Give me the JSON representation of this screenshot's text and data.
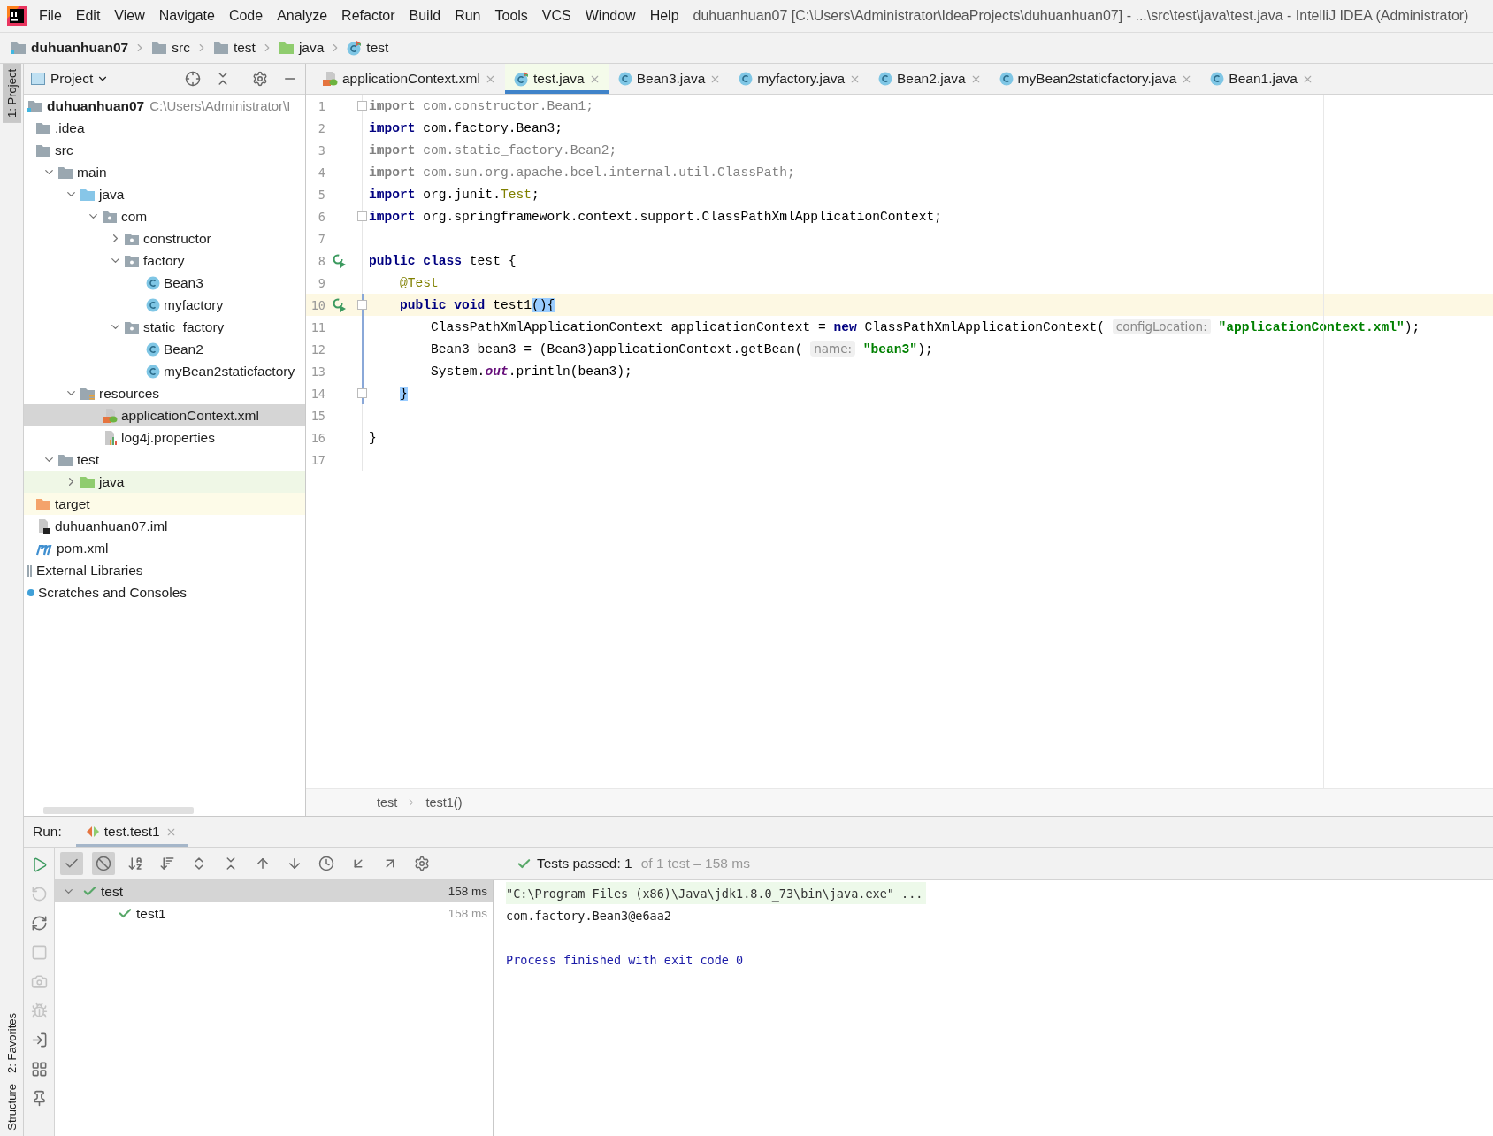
{
  "window": {
    "title": "duhuanhuan07 [C:\\Users\\Administrator\\IdeaProjects\\duhuanhuan07] - ...\\src\\test\\java\\test.java - IntelliJ IDEA (Administrator)"
  },
  "menu": [
    "File",
    "Edit",
    "View",
    "Navigate",
    "Code",
    "Analyze",
    "Refactor",
    "Build",
    "Run",
    "Tools",
    "VCS",
    "Window",
    "Help"
  ],
  "navigation_bar": [
    {
      "label": "duhuanhuan07",
      "kind": "module"
    },
    {
      "label": "src",
      "kind": "folder"
    },
    {
      "label": "test",
      "kind": "folder"
    },
    {
      "label": "java",
      "kind": "test-folder"
    },
    {
      "label": "test",
      "kind": "test-class"
    }
  ],
  "side_stripe": {
    "top": [
      "1: Project"
    ],
    "bottom": [
      "2: Favorites",
      "Structure"
    ]
  },
  "project_panel": {
    "title": "Project",
    "tree": [
      {
        "label": "duhuanhuan07",
        "path": "C:\\Users\\Administrator\\I",
        "kind": "module",
        "selected": false,
        "children": [
          {
            "label": ".idea",
            "kind": "folder",
            "selected": false
          },
          {
            "label": "src",
            "kind": "folder",
            "selected": false,
            "children": [
              {
                "label": "main",
                "kind": "folder",
                "expanded": true,
                "selected": false,
                "children": [
                  {
                    "label": "java",
                    "kind": "source-folder",
                    "expanded": true,
                    "selected": false,
                    "children": [
                      {
                        "label": "com",
                        "kind": "package",
                        "expanded": true,
                        "selected": false,
                        "children": [
                          {
                            "label": "constructor",
                            "kind": "package",
                            "expanded": false,
                            "selected": false
                          },
                          {
                            "label": "factory",
                            "kind": "package",
                            "expanded": true,
                            "selected": false,
                            "children": [
                              {
                                "label": "Bean3",
                                "kind": "class",
                                "selected": false
                              },
                              {
                                "label": "myfactory",
                                "kind": "class",
                                "selected": false
                              }
                            ]
                          },
                          {
                            "label": "static_factory",
                            "kind": "package",
                            "expanded": true,
                            "selected": false,
                            "children": [
                              {
                                "label": "Bean2",
                                "kind": "class",
                                "selected": false
                              },
                              {
                                "label": "myBean2staticfactory",
                                "kind": "class",
                                "selected": false
                              }
                            ]
                          }
                        ]
                      }
                    ]
                  },
                  {
                    "label": "resources",
                    "kind": "resources-folder",
                    "expanded": true,
                    "selected": false,
                    "children": [
                      {
                        "label": "applicationContext.xml",
                        "kind": "xml",
                        "selected": true
                      },
                      {
                        "label": "log4j.properties",
                        "kind": "properties",
                        "selected": false
                      }
                    ]
                  }
                ]
              },
              {
                "label": "test",
                "kind": "folder",
                "expanded": true,
                "selected": false,
                "children": [
                  {
                    "label": "java",
                    "kind": "test-folder",
                    "expanded": false,
                    "selected": false,
                    "test_sources": true
                  }
                ]
              }
            ]
          },
          {
            "label": "target",
            "kind": "excluded-folder",
            "selected": false,
            "excluded": true
          },
          {
            "label": "duhuanhuan07.iml",
            "kind": "module-file",
            "selected": false
          },
          {
            "label": "pom.xml",
            "kind": "maven",
            "selected": false
          }
        ]
      },
      {
        "label": "External Libraries",
        "kind": "library",
        "selected": false
      },
      {
        "label": "Scratches and Consoles",
        "kind": "scratches",
        "selected": false
      }
    ]
  },
  "editor": {
    "tabs": [
      {
        "label": "applicationContext.xml",
        "kind": "xml",
        "selected": false
      },
      {
        "label": "test.java",
        "kind": "test-class",
        "selected": true
      },
      {
        "label": "Bean3.java",
        "kind": "class",
        "selected": false
      },
      {
        "label": "myfactory.java",
        "kind": "class",
        "selected": false
      },
      {
        "label": "Bean2.java",
        "kind": "class",
        "selected": false
      },
      {
        "label": "myBean2staticfactory.java",
        "kind": "class",
        "selected": false
      },
      {
        "label": "Bean1.java",
        "kind": "class",
        "selected": false
      }
    ],
    "lines": [
      {
        "number": "1",
        "fold": true,
        "tokens": [
          {
            "kind": "unused-kw",
            "text": "import"
          },
          {
            "kind": "unused",
            "text": " com.constructor.Bean1;"
          }
        ]
      },
      {
        "number": "2",
        "tokens": [
          {
            "kind": "kw",
            "text": "import"
          },
          {
            "kind": "plain",
            "text": " com.factory.Bean3;"
          }
        ]
      },
      {
        "number": "3",
        "tokens": [
          {
            "kind": "unused-kw",
            "text": "import"
          },
          {
            "kind": "unused",
            "text": " com.static_factory.Bean2;"
          }
        ]
      },
      {
        "number": "4",
        "tokens": [
          {
            "kind": "unused-kw",
            "text": "import"
          },
          {
            "kind": "unused",
            "text": " com.sun.org.apache.bcel.internal.util.ClassPath;"
          }
        ]
      },
      {
        "number": "5",
        "tokens": [
          {
            "kind": "kw",
            "text": "import"
          },
          {
            "kind": "plain",
            "text": " org.junit."
          },
          {
            "kind": "ann",
            "text": "Test"
          },
          {
            "kind": "plain",
            "text": ";"
          }
        ]
      },
      {
        "number": "6",
        "fold": true,
        "tokens": [
          {
            "kind": "kw",
            "text": "import"
          },
          {
            "kind": "plain",
            "text": " org.springframework.context.support.ClassPathXmlApplicationContext;"
          }
        ]
      },
      {
        "number": "7"
      },
      {
        "number": "8",
        "run": true,
        "tokens": [
          {
            "kind": "kw",
            "text": "public class"
          },
          {
            "kind": "plain",
            "text": " test {"
          }
        ]
      },
      {
        "number": "9",
        "tokens": [
          {
            "kind": "ann",
            "text": "    @Test"
          }
        ]
      },
      {
        "number": "10",
        "run": true,
        "fold": true,
        "current": true,
        "changed": true,
        "tokens": [
          {
            "kind": "kw",
            "text": "    public void"
          },
          {
            "kind": "plain",
            "text": " test1"
          },
          {
            "kind": "match",
            "text": "(){"
          }
        ]
      },
      {
        "number": "11",
        "changed": true,
        "tokens": [
          {
            "kind": "plain",
            "text": "        ClassPathXmlApplicationContext applicationContext = "
          },
          {
            "kind": "kw",
            "text": "new"
          },
          {
            "kind": "plain",
            "text": " ClassPathXmlApplicationContext( "
          },
          {
            "kind": "hint",
            "text": "configLocation:"
          },
          {
            "kind": "str",
            "text": " \"applicationContext.xml\""
          },
          {
            "kind": "plain",
            "text": ");"
          }
        ]
      },
      {
        "number": "12",
        "changed": true,
        "tokens": [
          {
            "kind": "plain",
            "text": "        Bean3 bean3 = (Bean3)applicationContext.getBean( "
          },
          {
            "kind": "hint",
            "text": "name:"
          },
          {
            "kind": "str",
            "text": " \"bean3\""
          },
          {
            "kind": "plain",
            "text": ");"
          }
        ]
      },
      {
        "number": "13",
        "changed": true,
        "tokens": [
          {
            "kind": "plain",
            "text": "        System."
          },
          {
            "kind": "static",
            "text": "out"
          },
          {
            "kind": "plain",
            "text": ".println(bean3);"
          }
        ]
      },
      {
        "number": "14",
        "fold": true,
        "changed": true,
        "tokens": [
          {
            "kind": "match",
            "text": "    }"
          }
        ]
      },
      {
        "number": "15"
      },
      {
        "number": "16",
        "tokens": [
          {
            "kind": "plain",
            "text": "}"
          }
        ]
      },
      {
        "number": "17"
      }
    ],
    "breadcrumb": [
      "test",
      "test1()"
    ]
  },
  "run_panel": {
    "label": "Run:",
    "tab": "test.test1",
    "status": "Tests passed: 1",
    "status_detail": "of 1 test – 158 ms",
    "tests": [
      {
        "label": "test",
        "time": "158 ms",
        "selected": true,
        "expanded": true,
        "children": [
          {
            "label": "test1",
            "time": "158 ms",
            "selected": false
          }
        ]
      }
    ],
    "console": [
      {
        "kind": "command",
        "text": "\"C:\\Program Files (x86)\\Java\\jdk1.8.0_73\\bin\\java.exe\" ..."
      },
      {
        "kind": "output",
        "text": "com.factory.Bean3@e6aa2"
      },
      {
        "kind": "exit",
        "text": "Process finished with exit code 0"
      }
    ]
  }
}
